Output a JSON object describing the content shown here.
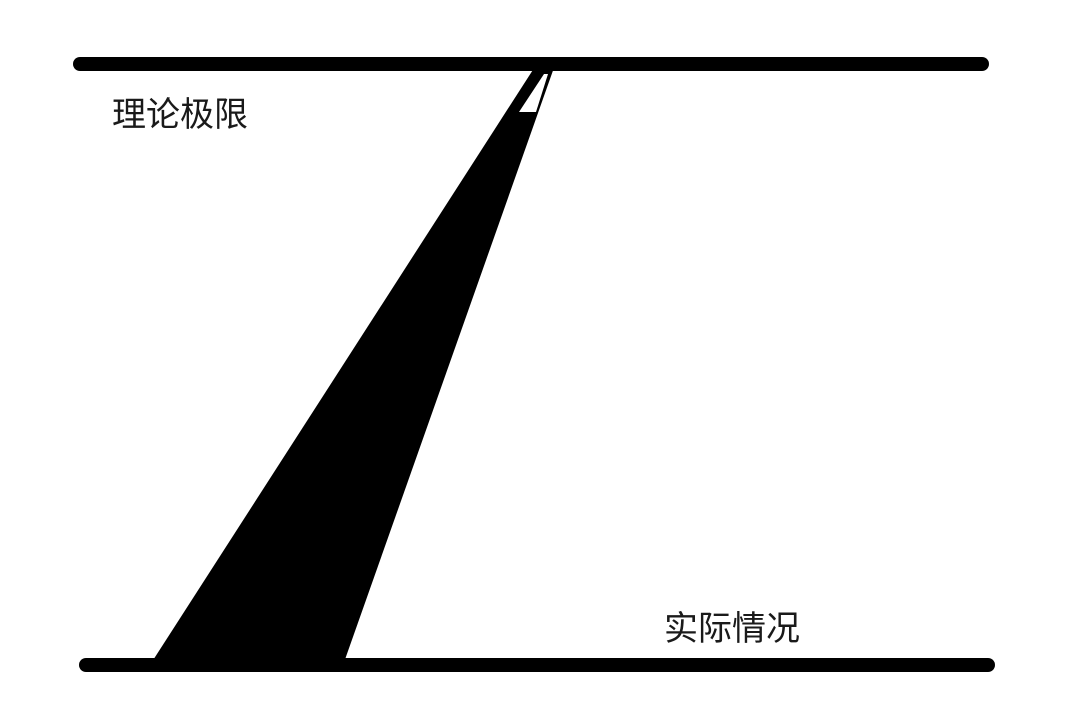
{
  "labels": {
    "top": "理论极限",
    "bottom": "实际情况"
  }
}
